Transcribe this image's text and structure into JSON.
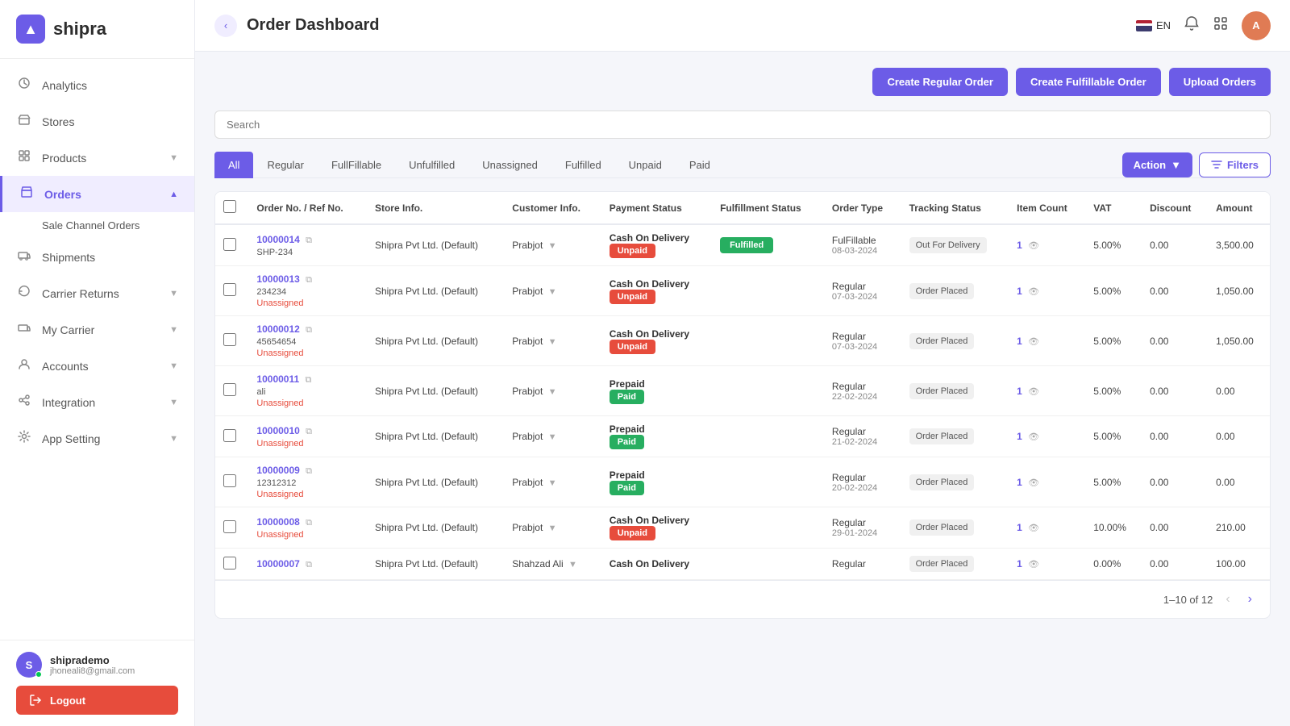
{
  "sidebar": {
    "logo_text": "shipra",
    "items": [
      {
        "id": "analytics",
        "label": "Analytics",
        "icon": "👤",
        "has_arrow": false
      },
      {
        "id": "stores",
        "label": "Stores",
        "icon": "🏪",
        "has_arrow": false
      },
      {
        "id": "products",
        "label": "Products",
        "icon": "📦",
        "has_arrow": true
      },
      {
        "id": "orders",
        "label": "Orders",
        "icon": "🛒",
        "has_arrow": true,
        "active": true
      },
      {
        "id": "shipments",
        "label": "Shipments",
        "icon": "🚚",
        "has_arrow": false
      },
      {
        "id": "carrier_returns",
        "label": "Carrier Returns",
        "icon": "↩",
        "has_arrow": true
      },
      {
        "id": "my_carrier",
        "label": "My Carrier",
        "icon": "🚛",
        "has_arrow": true
      },
      {
        "id": "accounts",
        "label": "Accounts",
        "icon": "👥",
        "has_arrow": true
      },
      {
        "id": "integration",
        "label": "Integration",
        "icon": "🔗",
        "has_arrow": true
      },
      {
        "id": "app_setting",
        "label": "App Setting",
        "icon": "⚙️",
        "has_arrow": true
      }
    ],
    "sub_items": [
      "Sale Channel Orders"
    ],
    "user": {
      "name": "shiprademo",
      "email": "jhoneali8@gmail.com",
      "initials": "S"
    },
    "logout_label": "Logout"
  },
  "topbar": {
    "title": "Order Dashboard",
    "lang": "EN",
    "user_initials": "A"
  },
  "toolbar": {
    "create_regular_label": "Create Regular Order",
    "create_fulfillable_label": "Create Fulfillable Order",
    "upload_orders_label": "Upload Orders",
    "search_placeholder": "Search"
  },
  "tabs": [
    {
      "id": "all",
      "label": "All",
      "active": true
    },
    {
      "id": "regular",
      "label": "Regular",
      "active": false
    },
    {
      "id": "fullfillable",
      "label": "FullFillable",
      "active": false
    },
    {
      "id": "unfulfilled",
      "label": "Unfulfilled",
      "active": false
    },
    {
      "id": "unassigned",
      "label": "Unassigned",
      "active": false
    },
    {
      "id": "fulfilled",
      "label": "Fulfilled",
      "active": false
    },
    {
      "id": "unpaid",
      "label": "Unpaid",
      "active": false
    },
    {
      "id": "paid",
      "label": "Paid",
      "active": false
    }
  ],
  "action_label": "Action",
  "filter_label": "Filters",
  "table": {
    "columns": [
      "",
      "Order No. / Ref No.",
      "Store Info.",
      "Customer Info.",
      "Payment Status",
      "Fulfillment Status",
      "Order Type",
      "Tracking Status",
      "Item Count",
      "VAT",
      "Discount",
      "Amount"
    ],
    "rows": [
      {
        "order_no": "10000014",
        "ref_no": "SHP-234",
        "unassigned": "",
        "store": "Shipra Pvt Ltd. (Default)",
        "customer": "Prabjot",
        "payment_method": "Cash On Delivery",
        "payment_status": "Unpaid",
        "payment_status_type": "unpaid",
        "fulfillment_status": "Fulfilled",
        "fulfillment_type": "fulfilled",
        "order_type": "FulFillable",
        "order_date": "08-03-2024",
        "tracking": "Out For Delivery",
        "item_count": "1",
        "vat": "5.00%",
        "discount": "0.00",
        "amount": "3,500.00"
      },
      {
        "order_no": "10000013",
        "ref_no": "234234",
        "unassigned": "Unassigned",
        "store": "Shipra Pvt Ltd. (Default)",
        "customer": "Prabjot",
        "payment_method": "Cash On Delivery",
        "payment_status": "Unpaid",
        "payment_status_type": "unpaid",
        "fulfillment_status": "",
        "fulfillment_type": "",
        "order_type": "Regular",
        "order_date": "07-03-2024",
        "tracking": "Order Placed",
        "item_count": "1",
        "vat": "5.00%",
        "discount": "0.00",
        "amount": "1,050.00"
      },
      {
        "order_no": "10000012",
        "ref_no": "45654654",
        "unassigned": "Unassigned",
        "store": "Shipra Pvt Ltd. (Default)",
        "customer": "Prabjot",
        "payment_method": "Cash On Delivery",
        "payment_status": "Unpaid",
        "payment_status_type": "unpaid",
        "fulfillment_status": "",
        "fulfillment_type": "",
        "order_type": "Regular",
        "order_date": "07-03-2024",
        "tracking": "Order Placed",
        "item_count": "1",
        "vat": "5.00%",
        "discount": "0.00",
        "amount": "1,050.00"
      },
      {
        "order_no": "10000011",
        "ref_no": "ali",
        "unassigned": "Unassigned",
        "store": "Shipra Pvt Ltd. (Default)",
        "customer": "Prabjot",
        "payment_method": "Prepaid",
        "payment_status": "Paid",
        "payment_status_type": "paid",
        "fulfillment_status": "",
        "fulfillment_type": "",
        "order_type": "Regular",
        "order_date": "22-02-2024",
        "tracking": "Order Placed",
        "item_count": "1",
        "vat": "5.00%",
        "discount": "0.00",
        "amount": "0.00"
      },
      {
        "order_no": "10000010",
        "ref_no": "",
        "unassigned": "Unassigned",
        "store": "Shipra Pvt Ltd. (Default)",
        "customer": "Prabjot",
        "payment_method": "Prepaid",
        "payment_status": "Paid",
        "payment_status_type": "paid",
        "fulfillment_status": "",
        "fulfillment_type": "",
        "order_type": "Regular",
        "order_date": "21-02-2024",
        "tracking": "Order Placed",
        "item_count": "1",
        "vat": "5.00%",
        "discount": "0.00",
        "amount": "0.00"
      },
      {
        "order_no": "10000009",
        "ref_no": "12312312",
        "unassigned": "Unassigned",
        "store": "Shipra Pvt Ltd. (Default)",
        "customer": "Prabjot",
        "payment_method": "Prepaid",
        "payment_status": "Paid",
        "payment_status_type": "paid",
        "fulfillment_status": "",
        "fulfillment_type": "",
        "order_type": "Regular",
        "order_date": "20-02-2024",
        "tracking": "Order Placed",
        "item_count": "1",
        "vat": "5.00%",
        "discount": "0.00",
        "amount": "0.00"
      },
      {
        "order_no": "10000008",
        "ref_no": "",
        "unassigned": "Unassigned",
        "store": "Shipra Pvt Ltd. (Default)",
        "customer": "Prabjot",
        "payment_method": "Cash On Delivery",
        "payment_status": "Unpaid",
        "payment_status_type": "unpaid",
        "fulfillment_status": "",
        "fulfillment_type": "",
        "order_type": "Regular",
        "order_date": "29-01-2024",
        "tracking": "Order Placed",
        "item_count": "1",
        "vat": "10.00%",
        "discount": "0.00",
        "amount": "210.00"
      },
      {
        "order_no": "10000007",
        "ref_no": "",
        "unassigned": "",
        "store": "Shipra Pvt Ltd. (Default)",
        "customer": "Shahzad Ali",
        "payment_method": "Cash On Delivery",
        "payment_status": "",
        "payment_status_type": "",
        "fulfillment_status": "",
        "fulfillment_type": "",
        "order_type": "Regular",
        "order_date": "",
        "tracking": "Order Placed",
        "item_count": "1",
        "vat": "0.00%",
        "discount": "0.00",
        "amount": "100.00"
      }
    ]
  },
  "pagination": {
    "text": "1–10 of 12",
    "prev_disabled": true,
    "next_disabled": false
  }
}
